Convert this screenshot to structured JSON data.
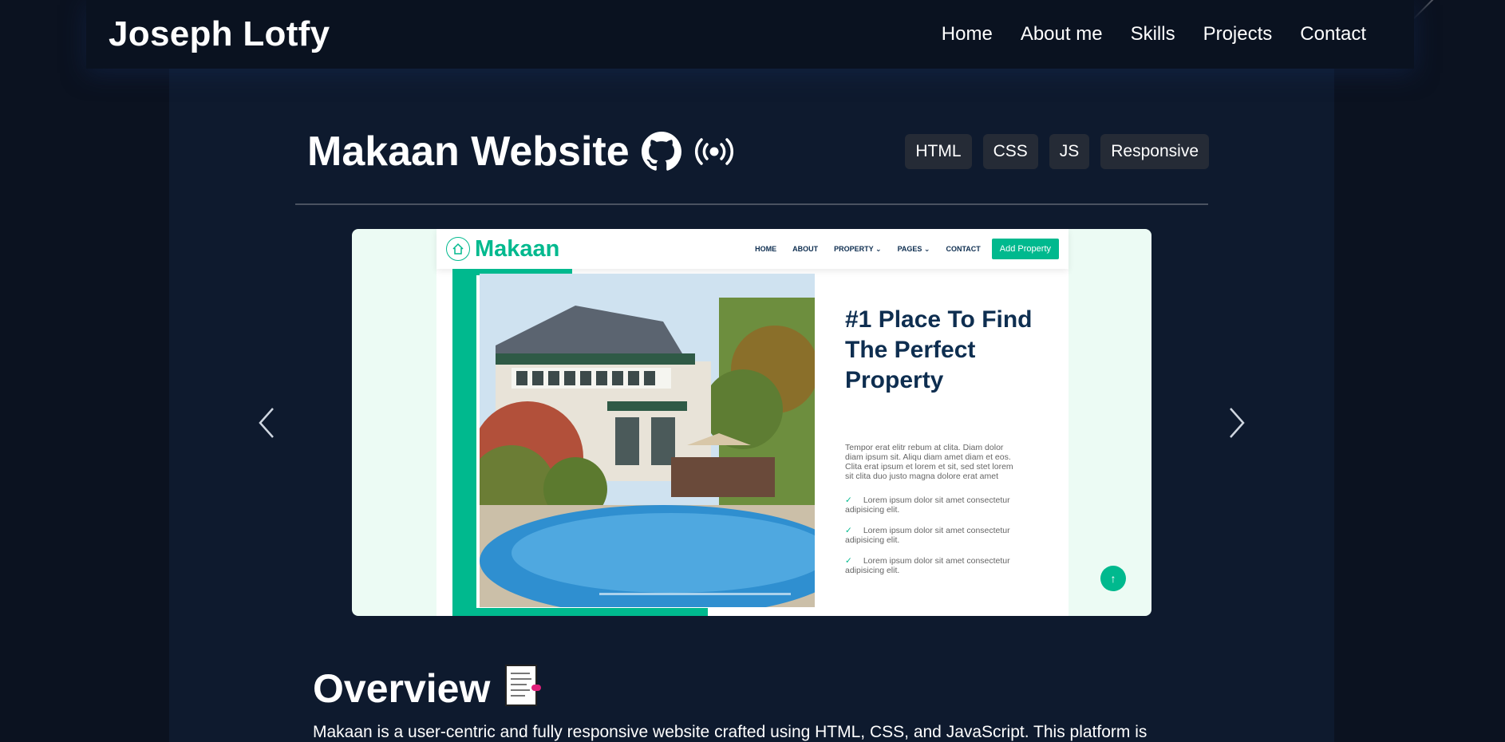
{
  "navbar": {
    "brand": "Joseph Lotfy",
    "links": [
      "Home",
      "About me",
      "Skills",
      "Projects",
      "Contact"
    ]
  },
  "project": {
    "title": "Makaan Website",
    "github_icon": "github-icon",
    "live_icon": "broadcast-icon",
    "tags": [
      "HTML",
      "CSS",
      "JS",
      "Responsive"
    ]
  },
  "carousel": {
    "prev_icon": "chevron-left-icon",
    "next_icon": "chevron-right-icon",
    "slide": {
      "brand": "Makaan",
      "menu": [
        "HOME",
        "ABOUT",
        "PROPERTY",
        "PAGES",
        "CONTACT"
      ],
      "cta": "Add Property",
      "heading": "#1 Place To Find The Perfect Property",
      "text": "Tempor erat elitr rebum at clita. Diam dolor diam ipsum sit. Aliqu diam amet diam et eos. Clita erat ipsum et lorem et sit, sed stet lorem sit clita duo justo magna dolore erat amet",
      "checks": [
        "Lorem ipsum dolor sit amet consectetur adipisicing elit.",
        "Lorem ipsum dolor sit amet consectetur adipisicing elit.",
        "Lorem ipsum dolor sit amet consectetur adipisicing elit."
      ]
    }
  },
  "overview": {
    "title": "Overview",
    "icon": "document-icon",
    "text": "Makaan is a user-centric and fully responsive website crafted using HTML, CSS, and JavaScript. This platform is"
  },
  "colors": {
    "accent_green": "#00b98e",
    "navy": "#0e2e50",
    "page_bg": "#0b1220",
    "panel_bg": "#0e1a2e"
  }
}
